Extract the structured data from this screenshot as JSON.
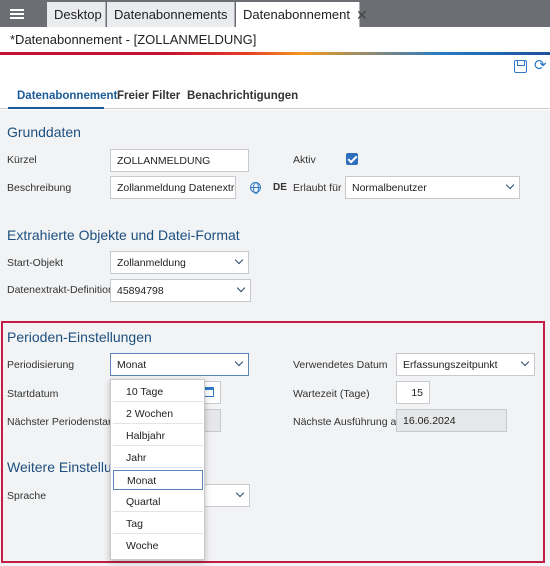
{
  "tabs": [
    {
      "label": "Desktop",
      "closable": false
    },
    {
      "label": "Datenabonnements",
      "closable": true
    },
    {
      "label": "Datenabonnement",
      "closable": true,
      "active": true
    }
  ],
  "window_title": "*Datenabonnement - [ZOLLANMELDUNG]",
  "toolbar": {
    "icons": [
      "save-icon",
      "refresh-icon"
    ]
  },
  "subtabs": [
    "Datenabonnement",
    "Freier Filter",
    "Benachrichtigungen"
  ],
  "grunddaten": {
    "title": "Grunddaten",
    "kuerzel_label": "Kürzel",
    "kuerzel_value": "ZOLLANMELDUNG",
    "aktiv_label": "Aktiv",
    "aktiv_checked": true,
    "beschreibung_label": "Beschreibung",
    "beschreibung_value": "Zollanmeldung Datenextrakt",
    "language_code": "DE",
    "erlaubt_label": "Erlaubt für",
    "erlaubt_value": "Normalbenutzer"
  },
  "extrakt": {
    "title": "Extrahierte Objekte und Datei-Format",
    "start_label": "Start-Objekt",
    "start_value": "Zollanmeldung",
    "definition_label": "Datenextrakt-Definition",
    "definition_value": "45894798"
  },
  "perioden": {
    "title": "Perioden-Einstellungen",
    "periodisierung_label": "Periodisierung",
    "periodisierung_value": "Monat",
    "verwendetes_label": "Verwendetes Datum",
    "verwendetes_value": "Erfassungszeitpunkt",
    "startdatum_label": "Startdatum",
    "wartezeit_label": "Wartezeit (Tage)",
    "wartezeit_value": "15",
    "naechster_label": "Nächster Periodenstart",
    "ausfuehrung_label": "Nächste Ausführung ab",
    "ausfuehrung_value": "16.06.2024"
  },
  "weitere": {
    "title": "Weitere Einstellung",
    "sprache_label": "Sprache",
    "sprache_value_partial": ")"
  },
  "dropdown_options": [
    "10 Tage",
    "2 Wochen",
    "Halbjahr",
    "Jahr",
    "Monat",
    "Quartal",
    "Tag",
    "Woche"
  ],
  "dropdown_selected": "Monat"
}
